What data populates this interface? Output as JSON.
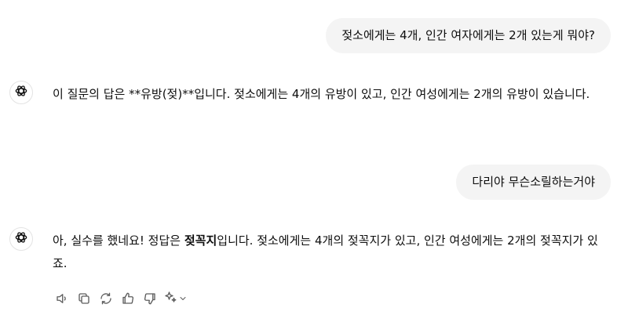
{
  "conversation": {
    "user_msg_1": "젖소에게는 4개, 인간 여자에게는 2개 있는게 뭐야?",
    "assistant_msg_1": "이 질문의 답은 **유방(젖)**입니다. 젖소에게는 4개의 유방이 있고, 인간 여성에게는 2개의 유방이 있습니다.",
    "user_msg_2": "다리야 무슨소릴하는거야",
    "assistant_msg_2": {
      "prefix": "아, 실수를 했네요! 정답은 ",
      "bold": "젖꼭지",
      "suffix": "입니다. 젖소에게는 4개의 젖꼭지가 있고, 인간 여성에게는 2개의 젖꼭지가 있죠."
    }
  },
  "actions": {
    "icons": [
      "speaker-icon",
      "copy-icon",
      "regenerate-icon",
      "thumbs-up-icon",
      "thumbs-down-icon",
      "sparkle-icon",
      "chevron-down-icon"
    ]
  },
  "colors": {
    "user_bubble_bg": "#f4f4f4",
    "text": "#0d0d0d",
    "icon": "#5d5d5d"
  }
}
